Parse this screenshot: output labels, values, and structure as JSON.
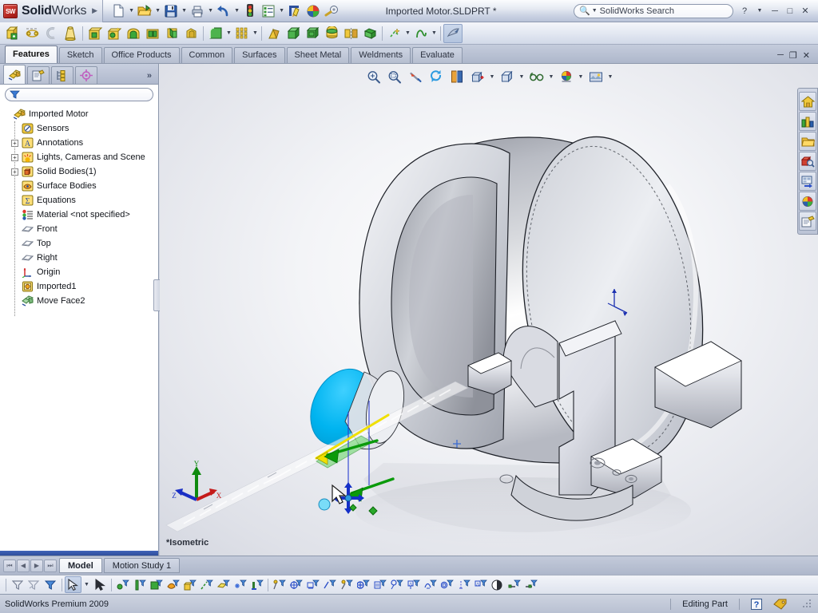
{
  "app": {
    "name_bold": "Solid",
    "name_light": "Works",
    "version_status": "SolidWorks Premium 2009"
  },
  "titlebar": {
    "document_title": "Imported Motor.SLDPRT *",
    "search_placeholder": "SolidWorks Search",
    "tools": [
      {
        "name": "new-document",
        "icon": "new-doc-icon",
        "has_dropdown": true
      },
      {
        "name": "open-document",
        "icon": "open-folder-icon",
        "has_dropdown": true
      },
      {
        "name": "save-document",
        "icon": "save-disk-icon",
        "has_dropdown": true
      },
      {
        "name": "print-document",
        "icon": "printer-icon",
        "has_dropdown": true
      },
      {
        "name": "undo",
        "icon": "undo-arrow-icon",
        "has_dropdown": true
      },
      {
        "name": "rebuild",
        "icon": "traffic-light-icon",
        "has_dropdown": false
      },
      {
        "name": "options",
        "icon": "options-list-icon",
        "has_dropdown": true
      },
      {
        "name": "edit-appearance",
        "icon": "edit-pencil-icon",
        "has_dropdown": false
      },
      {
        "name": "appearances",
        "icon": "color-wheel-icon",
        "has_dropdown": false
      },
      {
        "name": "measure",
        "icon": "measure-tape-icon",
        "has_dropdown": false
      }
    ],
    "window_buttons": [
      "help",
      "help-dropdown",
      "minimize",
      "restore",
      "close"
    ]
  },
  "command_toolbar": {
    "items": [
      {
        "name": "extruded-boss-base",
        "icon": "extrude-boss-icon"
      },
      {
        "name": "revolved-boss-base",
        "icon": "revolve-boss-icon"
      },
      {
        "name": "swept-boss-base",
        "icon": "sweep-boss-icon"
      },
      {
        "name": "lofted-boss-base",
        "icon": "loft-boss-icon"
      },
      {
        "name": "extruded-cut",
        "icon": "extrude-cut-icon"
      },
      {
        "name": "hole-wizard",
        "icon": "hole-wizard-icon"
      },
      {
        "name": "revolved-cut",
        "icon": "revolve-cut-icon"
      },
      {
        "name": "swept-cut",
        "icon": "sweep-cut-icon"
      },
      {
        "name": "lofted-cut",
        "icon": "loft-cut-icon"
      },
      {
        "name": "rib",
        "icon": "rib-icon"
      },
      {
        "name": "fillet",
        "icon": "fillet-icon",
        "has_dropdown": true
      },
      {
        "name": "linear-pattern",
        "icon": "linear-pattern-icon",
        "has_dropdown": true
      },
      {
        "name": "draft",
        "icon": "draft-icon"
      },
      {
        "name": "shell",
        "icon": "shell-icon"
      },
      {
        "name": "wrap",
        "icon": "wrap-icon"
      },
      {
        "name": "dome",
        "icon": "dome-icon"
      },
      {
        "name": "mirror",
        "icon": "mirror-icon"
      },
      {
        "name": "reference-geometry",
        "icon": "reference-geometry-icon",
        "has_dropdown": true
      },
      {
        "name": "curves",
        "icon": "curves-icon",
        "has_dropdown": true
      },
      {
        "name": "instant3d",
        "icon": "instant3d-icon",
        "pressed": true
      }
    ]
  },
  "command_tabs": {
    "tabs": [
      {
        "label": "Features",
        "active": true
      },
      {
        "label": "Sketch",
        "active": false
      },
      {
        "label": "Office Products",
        "active": false
      },
      {
        "label": "Common",
        "active": false
      },
      {
        "label": "Surfaces",
        "active": false
      },
      {
        "label": "Sheet Metal",
        "active": false
      },
      {
        "label": "Weldments",
        "active": false
      },
      {
        "label": "Evaluate",
        "active": false
      }
    ],
    "window_controls": [
      "minimize",
      "restore",
      "close"
    ]
  },
  "left_panel": {
    "tabs": [
      {
        "name": "feature-manager-tab",
        "icon": "feature-tree-icon",
        "active": true
      },
      {
        "name": "property-manager-tab",
        "icon": "property-page-icon",
        "active": false
      },
      {
        "name": "configuration-manager-tab",
        "icon": "configuration-icon",
        "active": false
      },
      {
        "name": "dimxpert-manager-tab",
        "icon": "dimxpert-target-icon",
        "active": false
      }
    ],
    "more_label": "»",
    "filter_placeholder": "",
    "tree": [
      {
        "label": "Imported Motor",
        "icon": "part-icon",
        "expandable": false,
        "level": 0
      },
      {
        "label": "Sensors",
        "icon": "sensors-icon",
        "expandable": false,
        "level": 1
      },
      {
        "label": "Annotations",
        "icon": "annotations-icon",
        "expandable": true,
        "level": 1
      },
      {
        "label": "Lights, Cameras and Scene",
        "icon": "lights-cameras-icon",
        "expandable": true,
        "level": 1
      },
      {
        "label": "Solid Bodies(1)",
        "icon": "solid-bodies-icon",
        "expandable": true,
        "level": 1
      },
      {
        "label": "Surface Bodies",
        "icon": "surface-bodies-icon",
        "expandable": false,
        "level": 1
      },
      {
        "label": "Equations",
        "icon": "equations-icon",
        "expandable": false,
        "level": 1
      },
      {
        "label": "Material <not specified>",
        "icon": "material-icon",
        "expandable": false,
        "level": 1
      },
      {
        "label": "Front",
        "icon": "plane-icon",
        "expandable": false,
        "level": 1
      },
      {
        "label": "Top",
        "icon": "plane-icon",
        "expandable": false,
        "level": 1
      },
      {
        "label": "Right",
        "icon": "plane-icon",
        "expandable": false,
        "level": 1
      },
      {
        "label": "Origin",
        "icon": "origin-icon",
        "expandable": false,
        "level": 1
      },
      {
        "label": "Imported1",
        "icon": "imported-feature-icon",
        "expandable": false,
        "level": 1
      },
      {
        "label": "Move Face2",
        "icon": "move-face-icon",
        "expandable": false,
        "level": 1
      }
    ]
  },
  "viewport": {
    "toolbar": [
      {
        "name": "zoom-to-fit",
        "icon": "zoom-fit-icon"
      },
      {
        "name": "zoom-to-area",
        "icon": "zoom-area-icon"
      },
      {
        "name": "previous-view",
        "icon": "previous-view-icon"
      },
      {
        "name": "rotate-view",
        "icon": "rotate-view-icon"
      },
      {
        "name": "section-view",
        "icon": "section-view-icon"
      },
      {
        "name": "view-orientation",
        "icon": "view-orientation-icon",
        "has_dropdown": true
      },
      {
        "name": "display-style",
        "icon": "display-style-icon",
        "has_dropdown": true
      },
      {
        "name": "hide-show-items",
        "icon": "glasses-icon",
        "has_dropdown": true
      },
      {
        "name": "edit-appearance",
        "icon": "appearance-ball-icon",
        "has_dropdown": true
      },
      {
        "name": "apply-scene",
        "icon": "apply-scene-icon",
        "has_dropdown": true
      }
    ],
    "task_pane": [
      {
        "name": "solidworks-resources",
        "icon": "home-house-icon"
      },
      {
        "name": "design-library",
        "icon": "design-library-icon"
      },
      {
        "name": "file-explorer",
        "icon": "folder-icon"
      },
      {
        "name": "search",
        "icon": "search-cube-icon"
      },
      {
        "name": "view-palette",
        "icon": "view-palette-icon"
      },
      {
        "name": "appearances-scenes",
        "icon": "color-wheel-icon"
      },
      {
        "name": "custom-properties",
        "icon": "custom-properties-icon"
      }
    ],
    "orientation_label": "*Isometric",
    "triad_axes": [
      {
        "axis": "Y",
        "color": "#008000"
      },
      {
        "axis": "X",
        "color": "#cc0000"
      },
      {
        "axis": "Z",
        "color": "#0000cc"
      }
    ],
    "selected_face_color": "#00b4f0",
    "model_name": "imported-motor-model"
  },
  "bottom_tabs": {
    "nav_buttons": [
      "first",
      "previous",
      "next",
      "last"
    ],
    "tabs": [
      {
        "label": "Model",
        "active": true
      },
      {
        "label": "Motion Study 1",
        "active": false
      }
    ]
  },
  "bottom_toolbar": {
    "items": [
      {
        "name": "filter-off",
        "icon": "filter-off-icon"
      },
      {
        "name": "clear-all-filters",
        "icon": "filter-clear-icon"
      },
      {
        "name": "toggle-selection-filter-toolbar",
        "icon": "filter-toggle-icon"
      },
      {
        "name": "select-tool",
        "icon": "select-arrow-icon",
        "pressed": true,
        "has_dropdown": true
      },
      {
        "name": "select-other",
        "icon": "select-other-icon"
      },
      {
        "name": "filter-vertices",
        "icon": "filter-vertex-icon"
      },
      {
        "name": "filter-edges",
        "icon": "filter-edge-icon"
      },
      {
        "name": "filter-faces",
        "icon": "filter-face-icon"
      },
      {
        "name": "filter-surface-bodies",
        "icon": "filter-surface-body-icon"
      },
      {
        "name": "filter-solid-bodies",
        "icon": "filter-solid-body-icon"
      },
      {
        "name": "filter-axes",
        "icon": "filter-axis-icon"
      },
      {
        "name": "filter-planes",
        "icon": "filter-plane-icon"
      },
      {
        "name": "filter-sketch-points",
        "icon": "filter-sketch-point-icon"
      },
      {
        "name": "filter-sketch-segments",
        "icon": "filter-sketch-segment-icon"
      },
      {
        "name": "filter-midpoints",
        "icon": "filter-midpoint-icon"
      },
      {
        "name": "filter-center-marks",
        "icon": "filter-center-mark-icon"
      },
      {
        "name": "filter-centerlines",
        "icon": "filter-centerline-icon"
      },
      {
        "name": "filter-dimensions",
        "icon": "filter-dimension-icon"
      },
      {
        "name": "filter-surface-finish",
        "icon": "filter-surface-finish-icon"
      },
      {
        "name": "filter-welds",
        "icon": "filter-weld-icon"
      },
      {
        "name": "filter-notes",
        "icon": "filter-note-icon"
      },
      {
        "name": "filter-balloons",
        "icon": "filter-balloon-icon"
      },
      {
        "name": "filter-datums",
        "icon": "filter-datum-icon"
      },
      {
        "name": "filter-annotations",
        "icon": "filter-annotation-icon"
      },
      {
        "name": "filter-cosmetic-threads",
        "icon": "filter-cosmetic-thread-icon"
      },
      {
        "name": "filter-connection-points",
        "icon": "filter-connection-point-icon"
      },
      {
        "name": "filter-route-points",
        "icon": "filter-route-point-icon"
      }
    ]
  },
  "statusbar": {
    "left_text": "SolidWorks Premium 2009",
    "edit_mode": "Editing Part",
    "help_icon": "help-question-icon",
    "tag_icon": "tag-icon"
  }
}
